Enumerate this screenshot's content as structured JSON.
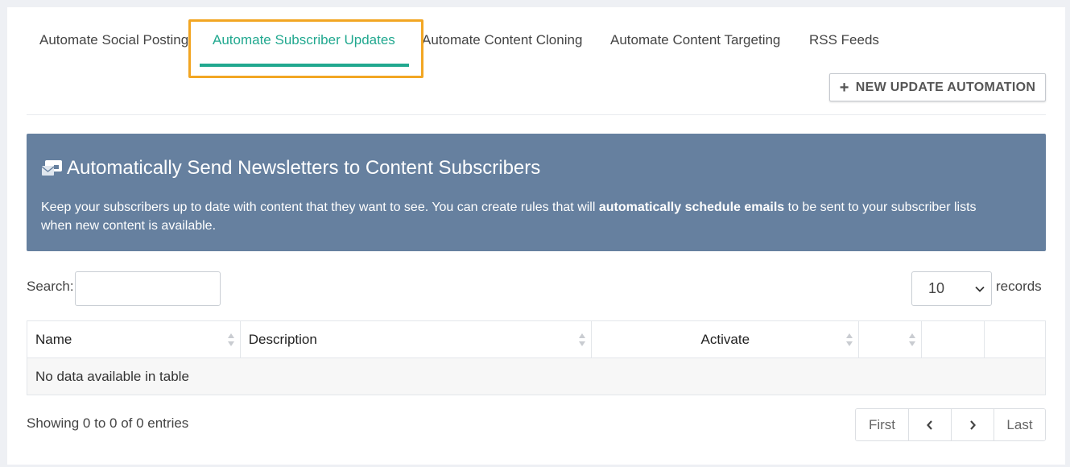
{
  "tabs": [
    {
      "label": "Automate Social Posting",
      "active": false
    },
    {
      "label": "Automate Subscriber Updates",
      "active": true
    },
    {
      "label": "Automate Content Cloning",
      "active": false
    },
    {
      "label": "Automate Content Targeting",
      "active": false
    },
    {
      "label": "RSS Feeds",
      "active": false
    }
  ],
  "toolbar": {
    "new_button_label": "NEW UPDATE AUTOMATION",
    "new_button_icon": "plus-icon"
  },
  "banner": {
    "icon": "newsletter-envelope-icon",
    "title": "Automatically Send Newsletters to Content Subscribers",
    "text_before": "Keep your subscribers up to date with content that they want to see. You can create rules that will ",
    "text_bold": "automatically schedule emails",
    "text_after": " to be sent to your subscriber lists when new content is available.",
    "background": "#66809f"
  },
  "search": {
    "label": "Search:",
    "value": ""
  },
  "records": {
    "selected": "10",
    "label": "records"
  },
  "table": {
    "columns": [
      "Name",
      "Description",
      "Activate",
      "",
      "",
      ""
    ],
    "empty_message": "No data available in table"
  },
  "footer": {
    "showing": "Showing 0 to 0 of 0 entries"
  },
  "pagination": {
    "first": "First",
    "prev": "‹",
    "next": "›",
    "last": "Last"
  },
  "colors": {
    "accent": "#21a88f",
    "highlight": "#f2a623"
  }
}
